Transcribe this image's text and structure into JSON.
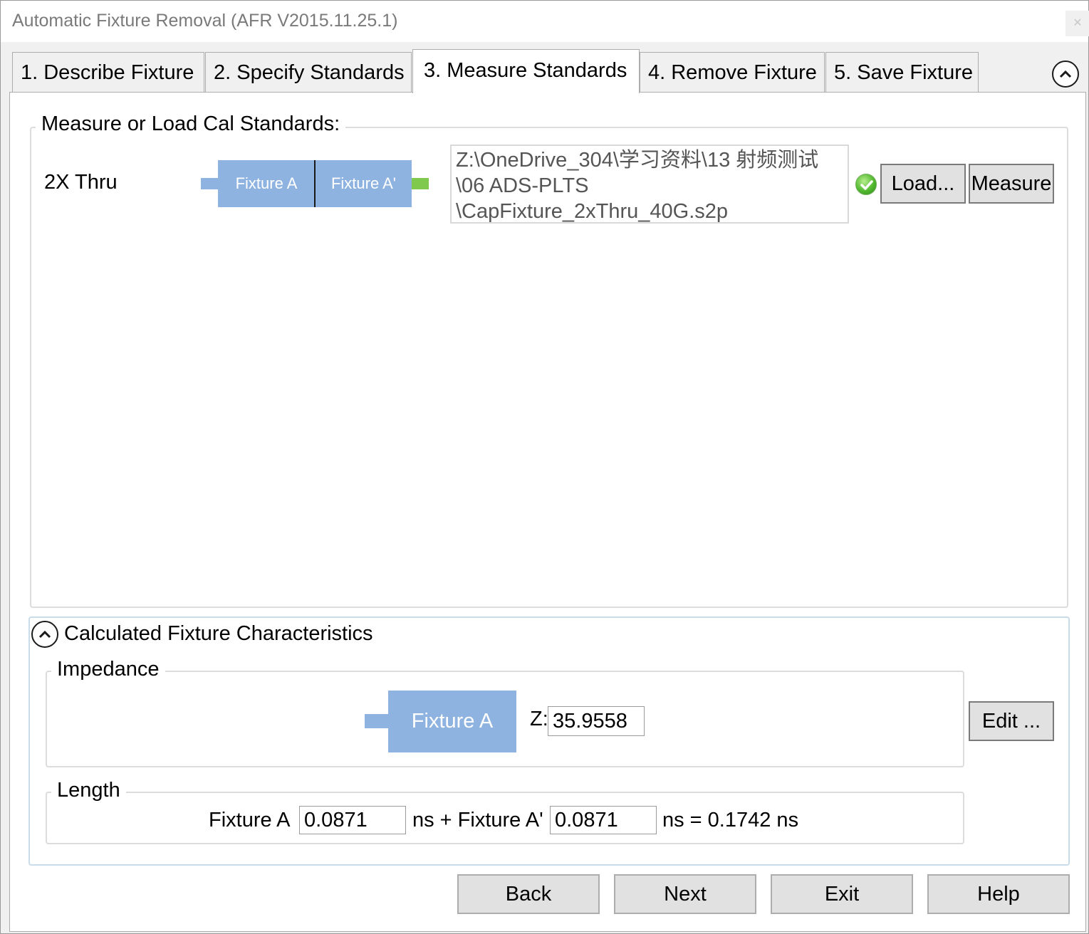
{
  "window": {
    "title": "Automatic Fixture Removal (AFR V2015.11.25.1)"
  },
  "tabs": [
    {
      "label": "1. Describe Fixture"
    },
    {
      "label": "2. Specify Standards"
    },
    {
      "label": "3. Measure Standards"
    },
    {
      "label": "4. Remove Fixture"
    },
    {
      "label": "5. Save Fixture"
    }
  ],
  "active_tab": "3. Measure Standards",
  "measure": {
    "group_title": "Measure or Load Cal Standards:",
    "standard_label": "2X Thru",
    "fixture_a": "Fixture A",
    "fixture_a_prime": "Fixture A'",
    "file_path_lines": [
      "Z:\\OneDrive_304\\学习资料\\13 射频测试",
      "\\06 ADS-PLTS",
      "\\CapFixture_2xThru_40G.s2p"
    ],
    "status_icon": "green-check-icon",
    "load_label": "Load...",
    "measure_label": "Measure"
  },
  "calculated": {
    "title": "Calculated Fixture Characteristics",
    "impedance": {
      "title": "Impedance",
      "fixture_label": "Fixture A",
      "z_label": "Z:",
      "z_value": "35.9558",
      "edit_label": "Edit ..."
    },
    "length": {
      "title": "Length",
      "fixture_a_label": "Fixture A",
      "fixture_a_value": "0.0871",
      "ns_plus": "ns + Fixture A'",
      "fixture_a_prime_value": "0.0871",
      "result_text": "ns = 0.1742 ns"
    }
  },
  "footer": {
    "back_label": "Back",
    "next_label": "Next",
    "exit_label": "Exit",
    "help_label": "Help"
  },
  "colors": {
    "fixture_blue": "#8fb3e0",
    "connector_green": "#7fc94f",
    "group_blue_border": "#c9dcea"
  }
}
